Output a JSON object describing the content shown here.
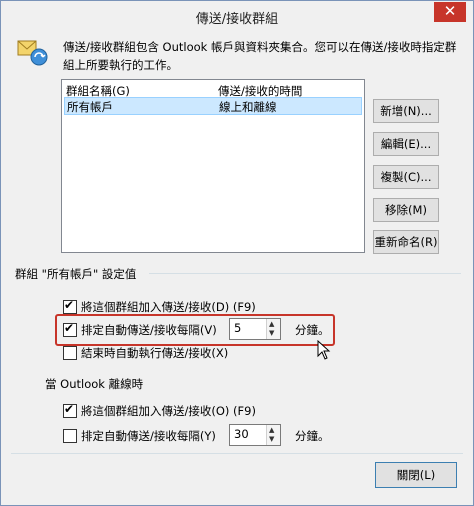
{
  "window": {
    "title": "傳送/接收群組",
    "close_glyph": "✕"
  },
  "info": {
    "line1": "傳送/接收群組包含 Outlook 帳戶與資料夾集合。您可以在傳送/接收時指定群",
    "line2": "組上所要執行的工作。"
  },
  "groups_list": {
    "col_name": "群組名稱(G)",
    "col_time": "傳送/接收的時間",
    "rows": [
      {
        "name": "所有帳戶",
        "time": "線上和離線"
      }
    ]
  },
  "buttons": {
    "new": "新增(N)...",
    "edit": "編輯(E)...",
    "copy": "複製(C)...",
    "remove": "移除(M)",
    "rename": "重新命名(R)",
    "close": "關閉(L)"
  },
  "settings_group": {
    "label": "群組 \"所有帳戶\" 設定值",
    "online": {
      "include": {
        "label": "將這個群組加入傳送/接收(D) (F9)",
        "checked": true
      },
      "schedule": {
        "label": "排定自動傳送/接收每隔(V)",
        "checked": true,
        "value": "5",
        "unit": "分鐘。"
      },
      "on_exit": {
        "label": "結束時自動執行傳送/接收(X)",
        "checked": false
      }
    },
    "offline_label": "當 Outlook 離線時",
    "offline": {
      "include": {
        "label": "將這個群組加入傳送/接收(O) (F9)",
        "checked": true
      },
      "schedule": {
        "label": "排定自動傳送/接收每隔(Y)",
        "checked": false,
        "value": "30",
        "unit": "分鐘。"
      }
    }
  },
  "colors": {
    "highlight": "#c7352a",
    "selection": "#cce8ff",
    "close_button": "#c7352a"
  }
}
